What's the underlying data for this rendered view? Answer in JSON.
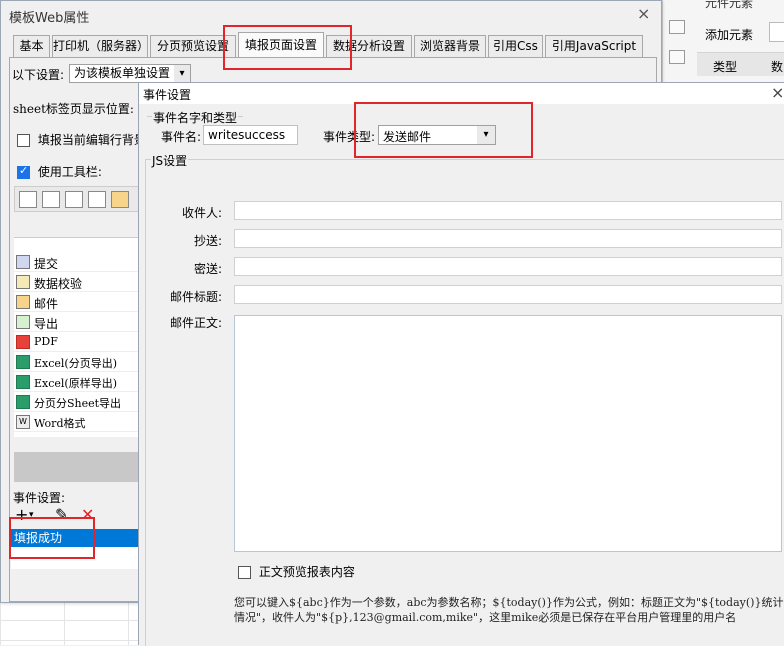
{
  "right_panel": {
    "top_text": "元件元素",
    "add_element": "添加元素",
    "col_type": "类型",
    "col_data": "数"
  },
  "template_dialog": {
    "title": "模板Web属性",
    "close": "×",
    "tabs": [
      {
        "label": "基本"
      },
      {
        "label": "打印机（服务器）"
      },
      {
        "label": "分页预览设置"
      },
      {
        "label": "填报页面设置"
      },
      {
        "label": "数据分析设置"
      },
      {
        "label": "浏览器背景"
      },
      {
        "label": "引用Css"
      },
      {
        "label": "引用JavaScript"
      }
    ],
    "setting_label": "以下设置:",
    "setting_value": "为该模板单独设置",
    "sheet_label_pos": "sheet标签页显示位置:",
    "chk_current_row": "填报当前编辑行背景",
    "chk_toolbar": "使用工具栏:",
    "tool_items": [
      {
        "label": "提交",
        "icon": "save-icon"
      },
      {
        "label": "数据校验",
        "icon": "pencil-icon"
      },
      {
        "label": "邮件",
        "icon": "mail-icon"
      },
      {
        "label": "导出",
        "icon": "export-icon"
      },
      {
        "label": "PDF",
        "icon": "pdf-icon"
      },
      {
        "label": "Excel(分页导出)",
        "icon": "excel-icon"
      },
      {
        "label": "Excel(原样导出)",
        "icon": "excel-icon"
      },
      {
        "label": "分页分Sheet导出",
        "icon": "excel-icon"
      },
      {
        "label": "Word格式",
        "icon": "word-icon"
      }
    ],
    "event_settings_label": "事件设置:",
    "event_items": [
      {
        "label": "填报成功"
      }
    ]
  },
  "event_dialog": {
    "title": "事件设置",
    "close": "×",
    "group_name_type": "事件名字和类型",
    "event_name_label": "事件名:",
    "event_name_value": "writesuccess",
    "event_type_label": "事件类型:",
    "event_type_value": "发送邮件",
    "js_group": "JS设置",
    "fields": [
      {
        "label": "收件人:",
        "value": ""
      },
      {
        "label": "抄送:",
        "value": ""
      },
      {
        "label": "密送:",
        "value": ""
      },
      {
        "label": "邮件标题:",
        "value": ""
      }
    ],
    "body_label": "邮件正文:",
    "body_value": "",
    "chk_preview": "正文预览报表内容",
    "hint": "您可以键入${abc}作为一个参数，abc为参数名称；${today()}作为公式，例如：标题正文为\"${today()}统计情况\"，收件人为\"${p},123@gmail.com,mike\"，这里mike必须是已保存在平台用户管理里的用户名"
  }
}
